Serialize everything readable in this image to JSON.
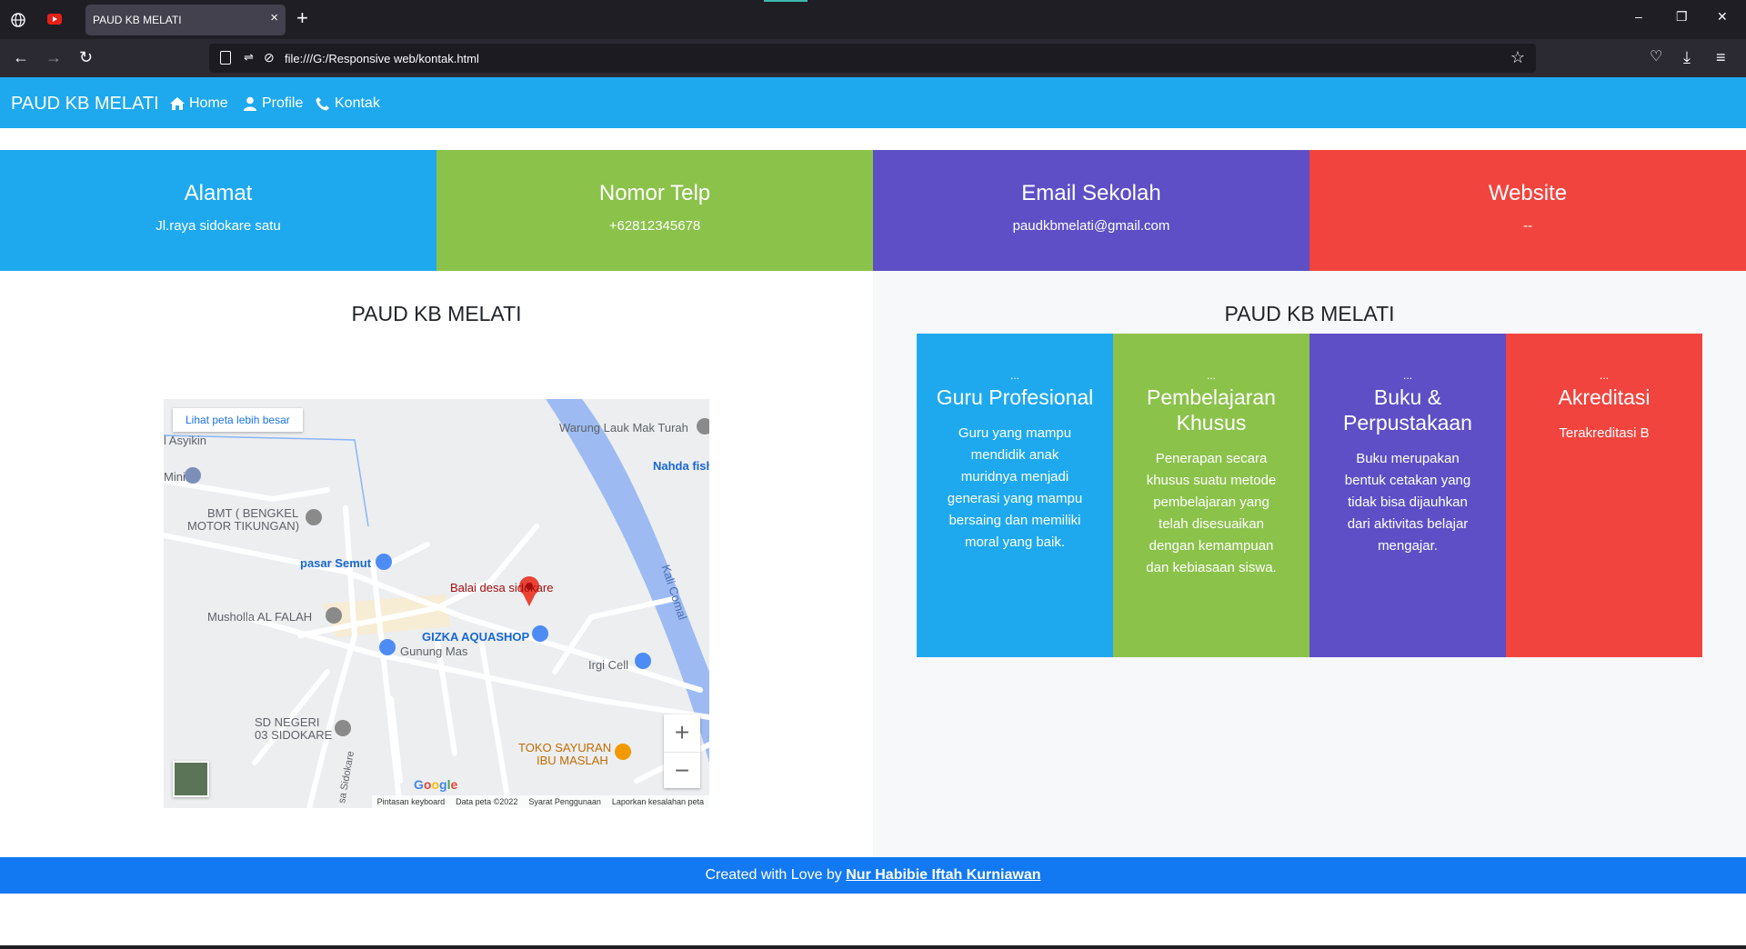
{
  "browser": {
    "tab_title": "PAUD KB MELATI",
    "tab_close": "×",
    "new_tab": "+",
    "url": "file:///G:/Responsive web/kontak.html",
    "win_minimize": "–",
    "win_restore": "❐",
    "win_close": "✕"
  },
  "site": {
    "brand": "PAUD KB MELATI",
    "nav": [
      {
        "label": "Home",
        "icon": "home-icon"
      },
      {
        "label": "Profile",
        "icon": "user-icon"
      },
      {
        "label": "Kontak",
        "icon": "phone-icon"
      }
    ]
  },
  "info": [
    {
      "title": "Alamat",
      "value": "Jl.raya sidokare satu",
      "color": "#1ea9ee"
    },
    {
      "title": "Nomor Telp",
      "value": "+62812345678",
      "color": "#8bc24a"
    },
    {
      "title": "Email Sekolah",
      "value": "paudkbmelati@gmail.com",
      "color": "#5e4fc6"
    },
    {
      "title": "Website",
      "value": "--",
      "color": "#f2443e"
    }
  ],
  "left": {
    "title": "PAUD KB MELATI"
  },
  "map": {
    "view_larger": "Lihat peta lebih besar",
    "labels": {
      "warung": "Warung Lauk Mak Turah",
      "nahda": "Nahda fish",
      "asyikin": "l Asyikin",
      "mini": "Mini",
      "bmt1": "BMT ( BENGKEL",
      "bmt2": "MOTOR TIKUNGAN)",
      "pasar": "pasar Semut",
      "balai": "Balai desa sidokare",
      "musholla": "Musholla AL FALAH",
      "gizka": "GIZKA AQUASHOP",
      "gunung": "Gunung Mas",
      "irgi": "Irgi Cell",
      "kali": "Kali Comal",
      "sd1": "SD NEGERI",
      "sd2": "03 SIDOKARE",
      "toko1": "TOKO SAYURAN",
      "toko2": "IBU MASLAH",
      "jalan": "sa Sidokare"
    },
    "zoom_in": "+",
    "zoom_out": "−",
    "google": "Google",
    "footer": [
      "Pintasan keyboard",
      "Data peta ©2022",
      "Syarat Penggunaan",
      "Laporkan kesalahan peta"
    ]
  },
  "right": {
    "title": "PAUD KB MELATI",
    "features": [
      {
        "dots": "...",
        "title": "Guru Profesional",
        "desc": "Guru yang mampu mendidik anak muridnya menjadi generasi yang mampu bersaing dan memiliki moral yang baik.",
        "color": "#1ea9ee"
      },
      {
        "dots": "...",
        "title": "Pembelajaran Khusus",
        "desc": "Penerapan secara khusus suatu metode pembelajaran yang telah disesuaikan dengan kemampuan dan kebiasaan siswa.",
        "color": "#8bc24a"
      },
      {
        "dots": "...",
        "title": "Buku & Perpustakaan",
        "desc": "Buku merupakan bentuk cetakan yang tidak bisa dijauhkan dari aktivitas belajar mengajar.",
        "color": "#5e4fc6"
      },
      {
        "dots": "...",
        "title": "Akreditasi",
        "desc": "Terakreditasi B",
        "color": "#f2443e"
      }
    ]
  },
  "footer": {
    "prefix": "Created with Love by ",
    "author": "Nur Habibie Iftah Kurniawan"
  }
}
